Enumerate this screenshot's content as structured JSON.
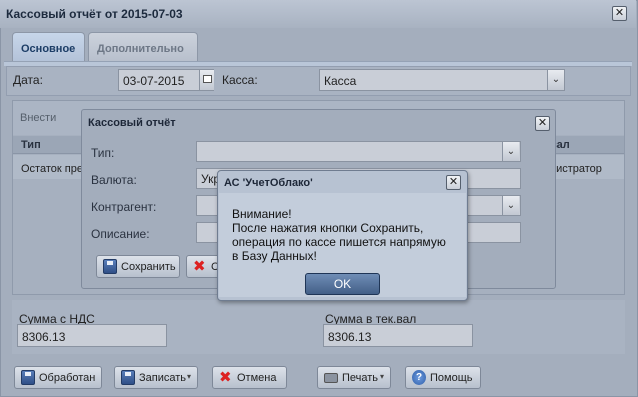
{
  "window": {
    "title": "Кассовый отчёт от 2015-07-03",
    "close_glyph": "✕"
  },
  "tabs": [
    {
      "label": "Основное",
      "active": true
    },
    {
      "label": "Дополнительно",
      "active": false
    }
  ],
  "form": {
    "date_label": "Дата:",
    "date_value": "03-07-2015",
    "kassa_label": "Касса:",
    "kassa_value": "Касса",
    "dropdown_glyph": "⌄"
  },
  "grid": {
    "toolbar_add": "Внести",
    "columns": [
      "Тип",
      "вал"
    ],
    "row": [
      "Остаток пре",
      "нистратор"
    ]
  },
  "sums": {
    "nds_label": "Сумма с НДС",
    "nds_value": "8306.13",
    "cur_label": "Сумма в тек.вал",
    "cur_value": "8306.13"
  },
  "footer_buttons": {
    "processed": "Обработан",
    "record": "Записать",
    "cancel": "Отмена",
    "print": "Печать",
    "help": "Помощь",
    "menu_arrow": "▾"
  },
  "report_dialog": {
    "title": "Кассовый отчёт",
    "type_label": "Тип:",
    "currency_label": "Валюта:",
    "currency_value": "Укр",
    "contractor_label": "Контрагент:",
    "description_label": "Описание:",
    "save_label": "Сохранить",
    "cancel_label": "С"
  },
  "alert": {
    "title": "АС 'УчетОблако'",
    "message_lines": [
      "Внимание!",
      "После нажатия кнопки Сохранить,",
      "операция по кассе пишется напрямую",
      "в Базу Данных!"
    ],
    "ok_label": "OK"
  },
  "colors": {
    "window_bg": "#a4aebd",
    "alert_ok_bg": "#435f87",
    "cancel_icon": "#dd2222"
  }
}
